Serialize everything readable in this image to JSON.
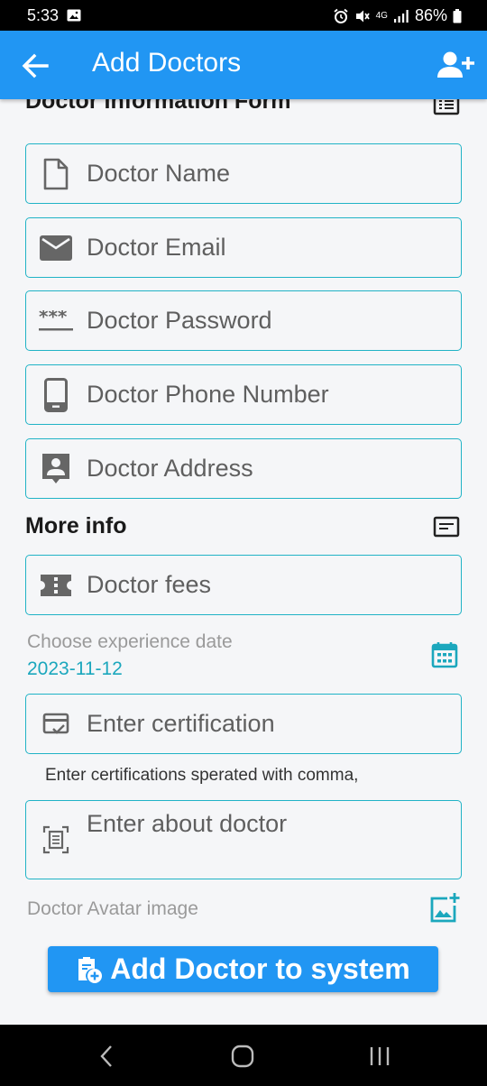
{
  "status_bar": {
    "time": "5:33",
    "network": "4G",
    "battery": "86%"
  },
  "app_bar": {
    "title": "Add Doctors",
    "back_icon": "arrow-back-icon",
    "action_icon": "person-add-icon"
  },
  "form": {
    "section_title": "Doctor Information Form",
    "fields": {
      "name": {
        "placeholder": "Doctor Name",
        "icon": "document-icon"
      },
      "email": {
        "placeholder": "Doctor Email",
        "icon": "mail-icon"
      },
      "password": {
        "placeholder": "Doctor Password",
        "icon": "password-icon"
      },
      "phone": {
        "placeholder": "Doctor Phone Number",
        "icon": "phone-icon"
      },
      "address": {
        "placeholder": "Doctor Address",
        "icon": "contact-icon"
      }
    },
    "more_info_title": "More info",
    "fees": {
      "placeholder": "Doctor fees",
      "icon": "ticket-icon"
    },
    "experience": {
      "label": "Choose experience date",
      "value": "2023-11-12",
      "icon": "calendar-icon"
    },
    "certification": {
      "placeholder": "Enter certification",
      "helper": "Enter certifications sperated with comma,",
      "icon": "card-check-icon"
    },
    "about": {
      "placeholder": "Enter about doctor",
      "icon": "document-scan-icon"
    },
    "avatar": {
      "label": "Doctor Avatar image",
      "icon": "add-photo-icon"
    },
    "submit_label": "Add Doctor to system"
  },
  "colors": {
    "primary": "#2196f3",
    "accent": "#20b3c6",
    "date_text": "#1ba7bd",
    "background": "#f5f6f8"
  }
}
